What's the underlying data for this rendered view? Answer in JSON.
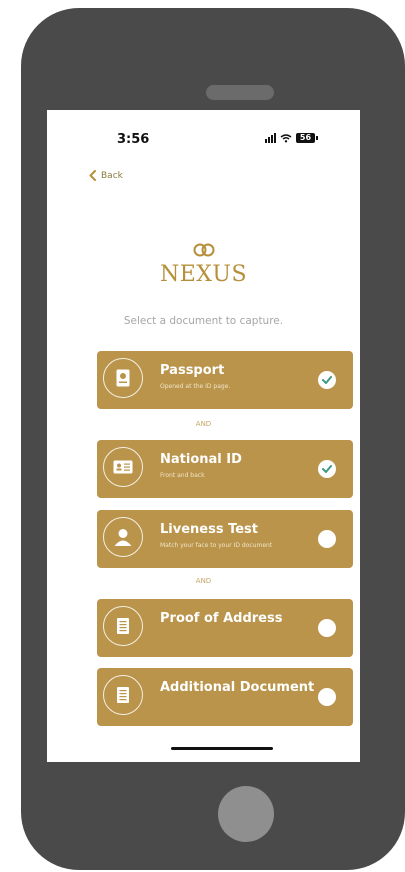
{
  "status_bar": {
    "time": "3:56",
    "battery": "56"
  },
  "nav": {
    "back_label": "Back"
  },
  "brand": {
    "logo_text": "NEXUS",
    "color": "#b68f3a"
  },
  "prompt": "Select a document to capture.",
  "documents": [
    {
      "title": "Passport",
      "subtitle": "Opened at the ID page.",
      "icon": "passport-icon",
      "checked": true
    },
    {
      "title": "National ID",
      "subtitle": "Front and back",
      "icon": "id-card-icon",
      "checked": true
    },
    {
      "title": "Liveness Test",
      "subtitle": "Match your face to your ID document",
      "icon": "person-icon",
      "checked": false
    },
    {
      "title": "Proof of Address",
      "subtitle": "",
      "icon": "document-icon",
      "checked": false
    },
    {
      "title": "Additional Document",
      "subtitle": "",
      "icon": "document-icon",
      "checked": false
    }
  ],
  "separators": [
    "AND",
    "AND"
  ],
  "colors": {
    "card": "#b9944a",
    "check": "#3f9a86",
    "accent": "#8b7a40"
  }
}
